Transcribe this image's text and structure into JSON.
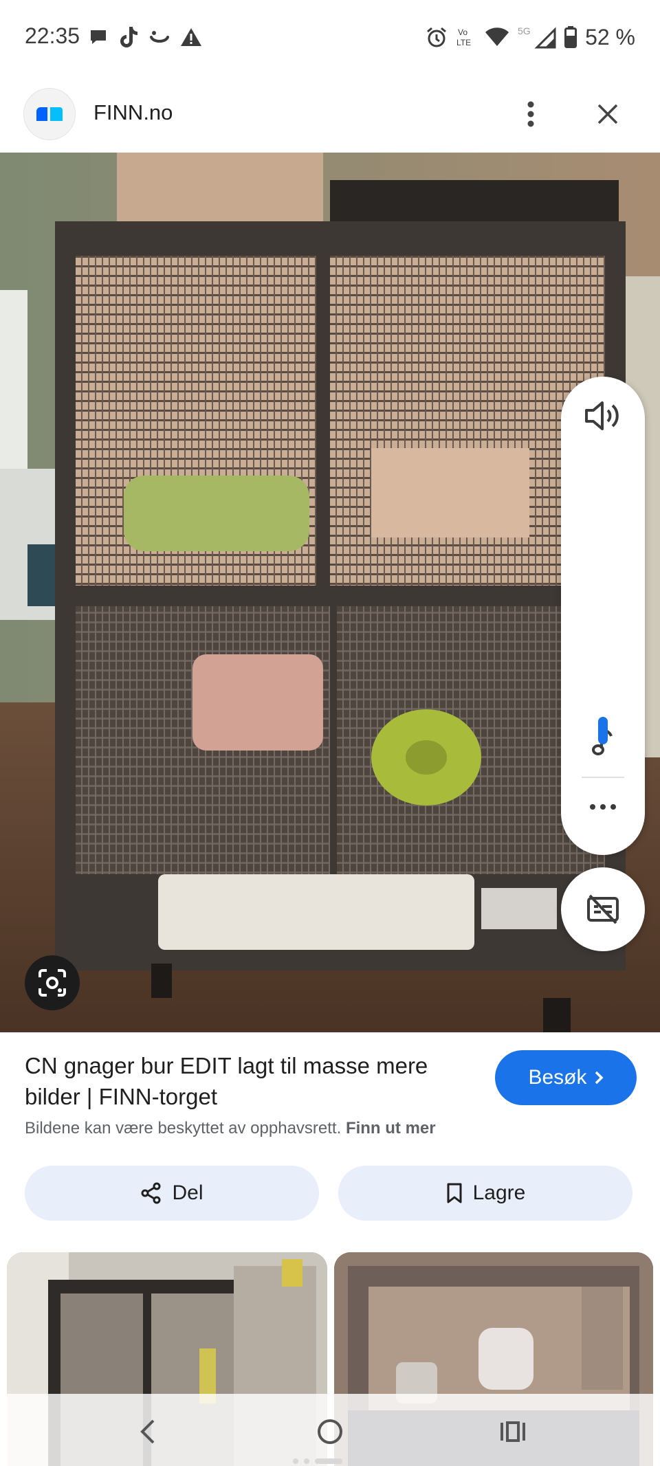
{
  "status_bar": {
    "time": "22:35",
    "left_icons": [
      "chat-bubble-icon",
      "tiktok-icon",
      "smile-icon",
      "warning-icon"
    ],
    "right_icons": [
      "alarm-icon",
      "volte-icon",
      "wifi-icon",
      "5g-signal-icon",
      "battery-icon"
    ],
    "battery": "52 %"
  },
  "header": {
    "site_title": "FINN.no",
    "logo_icon": "finn-logo-icon",
    "more_icon": "more-vert-icon",
    "close_icon": "close-icon"
  },
  "volume_panel": {
    "icons": [
      "speaker-icon",
      "music-note-icon",
      "more-horiz-icon",
      "captions-off-icon"
    ],
    "level": 0.07,
    "accent_color": "#1a73e8"
  },
  "result": {
    "title": "CN gnager bur EDIT lagt til masse mere bilder | FINN-torget",
    "visit_label": "Besøk",
    "copyright_text": "Bildene kan være beskyttet av opphavsrett.",
    "copyright_link": "Finn ut mer"
  },
  "actions": {
    "share_label": "Del",
    "save_label": "Lagre"
  },
  "nav_bar": {
    "icons": [
      "back-icon",
      "home-icon",
      "recents-icon"
    ]
  }
}
